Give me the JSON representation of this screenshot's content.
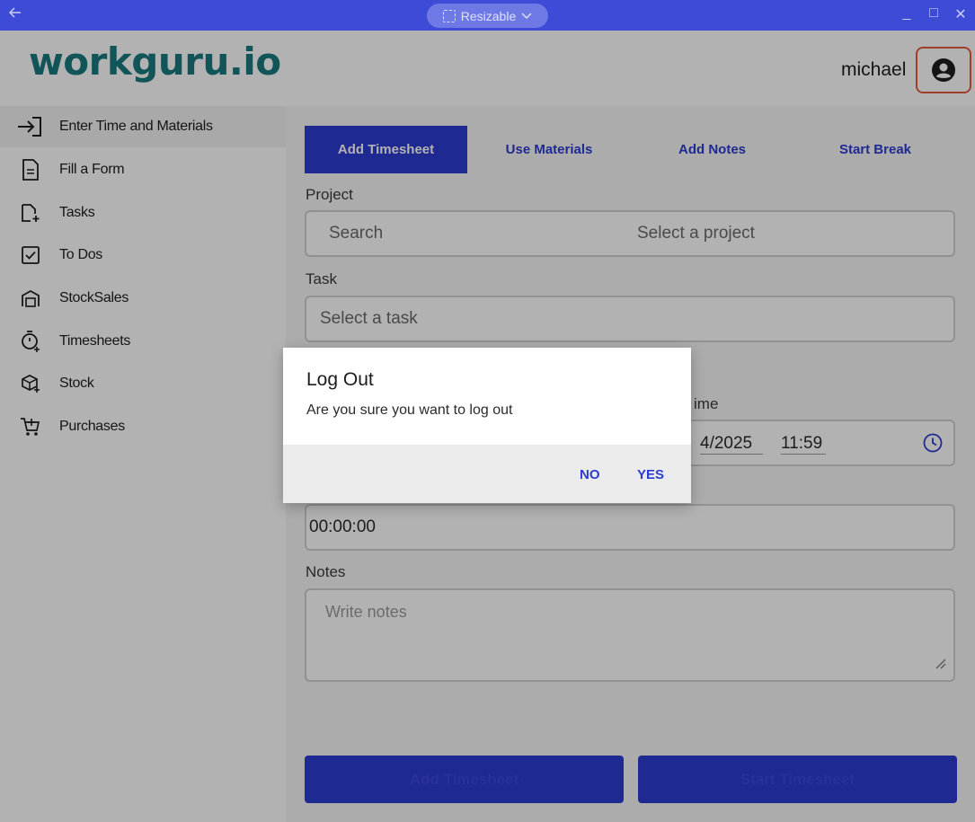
{
  "titlebar": {
    "mode_label": "Resizable"
  },
  "header": {
    "logo": "workguru.io",
    "username": "michael"
  },
  "sidebar": {
    "items": [
      {
        "label": "Enter Time and Materials",
        "icon": "login-arrow-icon"
      },
      {
        "label": "Fill a Form",
        "icon": "document-icon"
      },
      {
        "label": "Tasks",
        "icon": "add-file-icon"
      },
      {
        "label": "To Dos",
        "icon": "checkbox-icon"
      },
      {
        "label": "StockSales",
        "icon": "warehouse-icon"
      },
      {
        "label": "Timesheets",
        "icon": "timer-icon"
      },
      {
        "label": "Stock",
        "icon": "package-icon"
      },
      {
        "label": "Purchases",
        "icon": "cart-icon"
      }
    ]
  },
  "tabs": [
    {
      "label": "Add Timesheet",
      "active": true
    },
    {
      "label": "Use Materials"
    },
    {
      "label": "Add Notes"
    },
    {
      "label": "Start Break"
    }
  ],
  "form": {
    "project_label": "Project",
    "project_search": "Search",
    "project_placeholder": "Select a project",
    "task_label": "Task",
    "task_placeholder": "Select a task",
    "end_time_label_partial": "ime",
    "end_date_partial": "4/2025",
    "end_time": "11:59",
    "duration_value": "00:00:00",
    "notes_label": "Notes",
    "notes_placeholder": "Write notes"
  },
  "buttons": {
    "add_timesheet": "Add Timesheet",
    "start_timesheet": "Start Timesheet"
  },
  "dialog": {
    "title": "Log Out",
    "message": "Are you sure you want to log out",
    "no_label": "NO",
    "yes_label": "YES"
  },
  "colors": {
    "accent": "#2b3bd0",
    "titlebar": "#3d4bd6",
    "logo": "#1a7a80",
    "highlight": "#e55a3c"
  }
}
